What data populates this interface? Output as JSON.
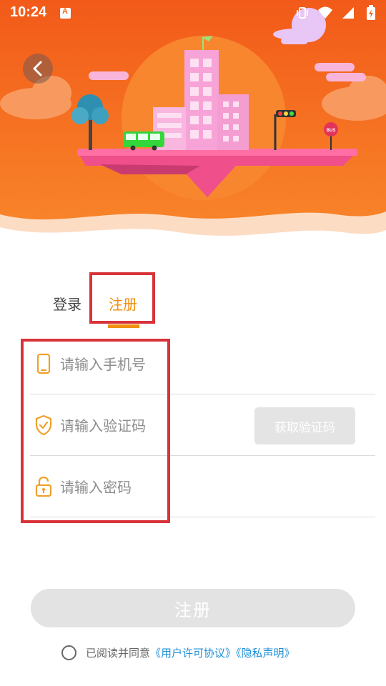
{
  "status_bar": {
    "time": "10:24",
    "icons": [
      "notification-icon",
      "vibrate-icon",
      "wifi-icon",
      "signal-icon",
      "battery-charging-icon"
    ]
  },
  "colors": {
    "header_orange": "#f26b1d",
    "accent_orange": "#f0900c",
    "link_blue": "#1e8fd8",
    "annotation_red": "#d9333a"
  },
  "tabs": {
    "login_label": "登录",
    "register_label": "注册",
    "active": "register"
  },
  "form": {
    "phone_placeholder": "请输入手机号",
    "phone_value": "",
    "code_placeholder": "请输入验证码",
    "code_value": "",
    "password_placeholder": "请输入密码",
    "password_value": "",
    "get_code_label": "获取验证码"
  },
  "submit": {
    "label": "注册"
  },
  "agreement": {
    "checked": false,
    "prefix": "已阅读并同意",
    "terms_link": "《用户许可协议》",
    "privacy_link": "《隐私声明》"
  },
  "illustration": {
    "bus_sign": "BUS"
  }
}
